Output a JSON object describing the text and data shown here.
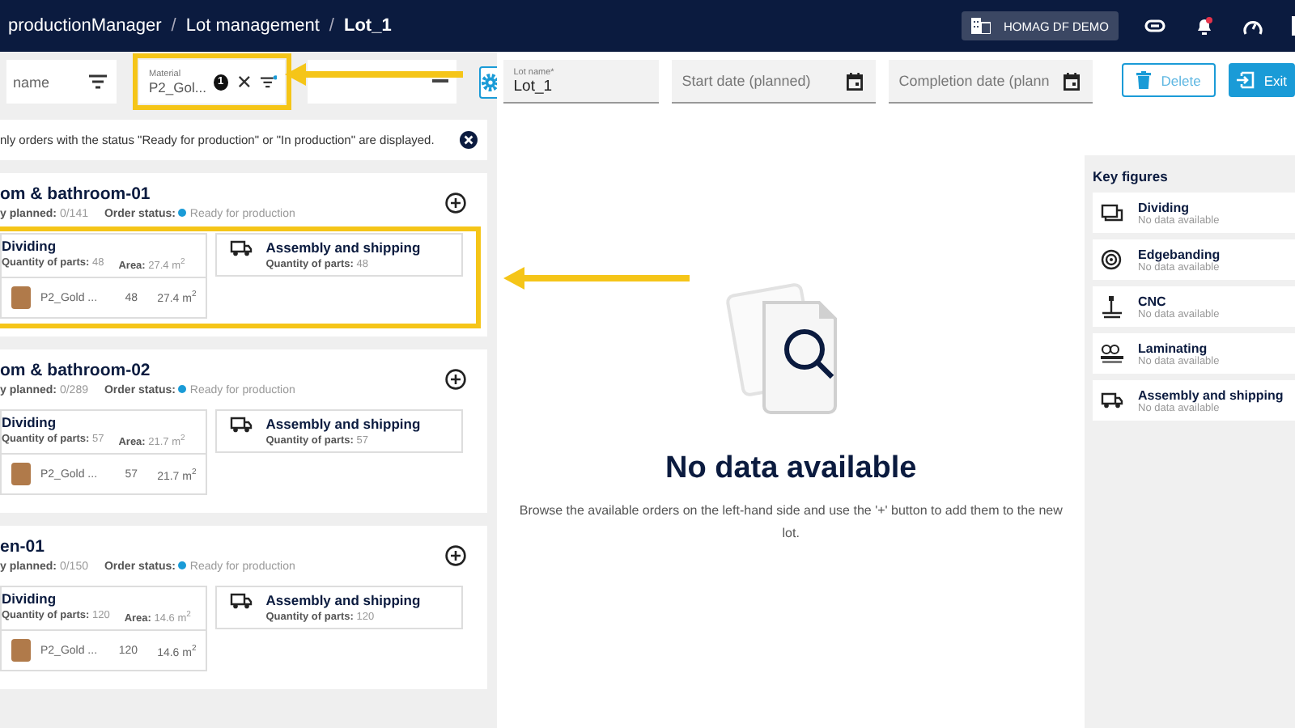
{
  "header": {
    "breadcrumbs": [
      {
        "label": "productionManager",
        "current": false
      },
      {
        "label": "Lot management",
        "current": false
      },
      {
        "label": "Lot_1",
        "current": true
      }
    ],
    "separator": "/",
    "tenant": "HOMAG DF DEMO",
    "notification_dot": true
  },
  "filters": [
    {
      "kind": "text",
      "placeholder": "name",
      "highlighted": false
    },
    {
      "kind": "chip",
      "label": "Material",
      "value": "P2_Gol...",
      "count": "1",
      "highlighted": true
    },
    {
      "kind": "blank",
      "highlighted": false
    }
  ],
  "info_banner": "nly orders with the status \"Ready for production\" or \"In production\" are displayed.",
  "orders": [
    {
      "title": "om & bathroom-01",
      "planned_label": "y planned:",
      "planned": "0/141",
      "status_label": "Order status:",
      "status": "Ready for production",
      "color": "#1a9bd7",
      "highlighted": true,
      "steps": [
        {
          "kind": "dividing",
          "name": "Dividing",
          "qty_label": "Quantity of parts:",
          "qty": "48",
          "area_label": "Area:",
          "area": "27.4 m$^{2}$",
          "material": "P2_Gold ...",
          "material_qty": "48",
          "material_area": "27.4 m$^{2}$"
        },
        {
          "kind": "shipping",
          "name": "Assembly and shipping",
          "qty_label": "Quantity of parts:",
          "qty": "48"
        }
      ]
    },
    {
      "title": "om & bathroom-02",
      "planned_label": "y planned:",
      "planned": "0/289",
      "status_label": "Order status:",
      "status": "Ready for production",
      "color": "#1a9bd7",
      "highlighted": false,
      "steps": [
        {
          "kind": "dividing",
          "name": "Dividing",
          "qty_label": "Quantity of parts:",
          "qty": "57",
          "area_label": "Area:",
          "area": "21.7 m$^{2}$",
          "material": "P2_Gold ...",
          "material_qty": "57",
          "material_area": "21.7 m$^{2}$"
        },
        {
          "kind": "shipping",
          "name": "Assembly and shipping",
          "qty_label": "Quantity of parts:",
          "qty": "57"
        }
      ]
    },
    {
      "title": "en-01",
      "planned_label": "y planned:",
      "planned": "0/150",
      "status_label": "Order status:",
      "status": "Ready for production",
      "color": "#1a9bd7",
      "highlighted": false,
      "steps": [
        {
          "kind": "dividing",
          "name": "Dividing",
          "qty_label": "Quantity of parts:",
          "qty": "120",
          "area_label": "Area:",
          "area": "14.6 m$^{2}$",
          "material": "P2_Gold ...",
          "material_qty": "120",
          "material_area": "14.6 m$^{2}$"
        },
        {
          "kind": "shipping",
          "name": "Assembly and shipping",
          "qty_label": "Quantity of parts:",
          "qty": "120"
        }
      ]
    }
  ],
  "lot_form": {
    "fields": [
      {
        "kind": "text",
        "label": "Lot name*",
        "value": "Lot_1"
      },
      {
        "kind": "date",
        "placeholder": "Start date (planned)"
      },
      {
        "kind": "date",
        "placeholder": "Completion date (plann"
      }
    ],
    "actions": [
      {
        "kind": "outline",
        "label": "Delete"
      },
      {
        "kind": "primary",
        "label": "Exit"
      }
    ]
  },
  "empty_state": {
    "title": "No data available",
    "text": "Browse the available orders on the left-hand side and use the '+' button to add them to the new lot."
  },
  "key_figures": {
    "title": "Key figures",
    "items": [
      {
        "kind": "dividing",
        "name": "Dividing",
        "value": "No data available"
      },
      {
        "kind": "edgebanding",
        "name": "Edgebanding",
        "value": "No data available"
      },
      {
        "kind": "cnc",
        "name": "CNC",
        "value": "No data available"
      },
      {
        "kind": "laminating",
        "name": "Laminating",
        "value": "No data available"
      },
      {
        "kind": "shipping",
        "name": "Assembly and shipping",
        "value": "No data available"
      }
    ]
  }
}
